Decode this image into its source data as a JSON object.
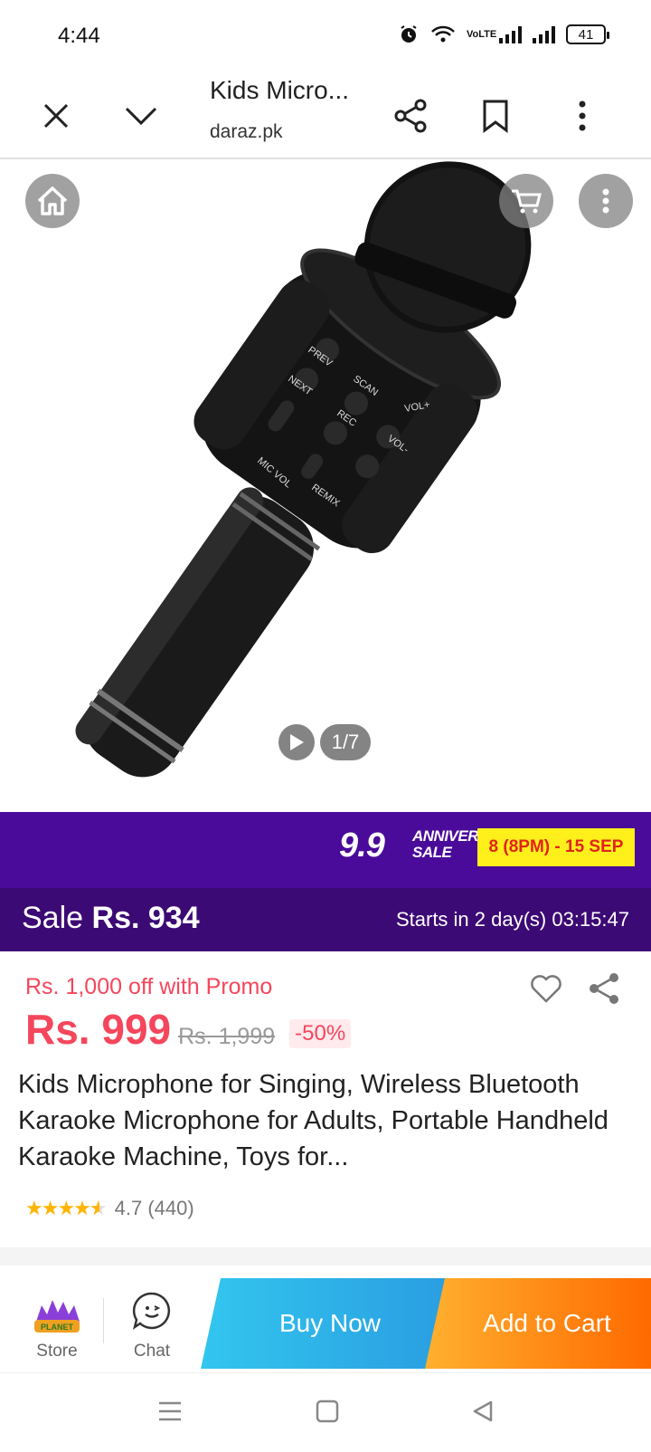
{
  "status_bar": {
    "time": "4:44",
    "network_label": "VoLTE",
    "battery": "41"
  },
  "toolbar": {
    "title": "Kids Micro...",
    "domain": "daraz.pk",
    "icons": [
      "close-icon",
      "chevron-down-icon",
      "share-icon",
      "bookmark-icon",
      "more-vert-icon"
    ]
  },
  "gallery": {
    "counter": "1/7",
    "icons": [
      "home-icon",
      "cart-icon",
      "more-icon",
      "play-icon"
    ],
    "mic_labels": {
      "prev": "PREV",
      "next": "NEXT",
      "scan": "SCAN",
      "rec": "REC",
      "vol_up": "VOL+",
      "vol_down": "VOL-",
      "mic_vol": "MIC VOL",
      "remix": "REMIX"
    }
  },
  "campaign": {
    "number": "9.9",
    "line1": "ANNIVERSARY",
    "line2": "SALE",
    "dates": "8 (8PM) - 15 SEP",
    "sale_label": "Sale",
    "sale_price": "Rs. 934",
    "countdown": "Starts in 2 day(s) 03:15:47",
    "colors": {
      "banner": "#4a0a9a",
      "sale_bar": "#3c0a74",
      "date_bg": "#ffef1a",
      "date_text": "#e0241b"
    }
  },
  "pricing": {
    "promo": "Rs. 1,000 off with Promo",
    "price": "Rs. 999",
    "original_price": "Rs. 1,999",
    "discount": "-50%",
    "accent": "#f5465c"
  },
  "product": {
    "title": "Kids Microphone for Singing, Wireless Bluetooth Karaoke Microphone for Adults, Portable Handheld Karaoke Machine, Toys for...",
    "stars": 4.7,
    "rating": "4.7",
    "reviews": "(440)"
  },
  "action_bar": {
    "store_label": "Store",
    "store_logo_text": "PLANET",
    "chat_label": "Chat",
    "buy_now": "Buy Now",
    "add_to_cart": "Add to Cart"
  },
  "system_nav": {
    "icons": [
      "menu-icon",
      "home-square-icon",
      "back-icon"
    ]
  }
}
